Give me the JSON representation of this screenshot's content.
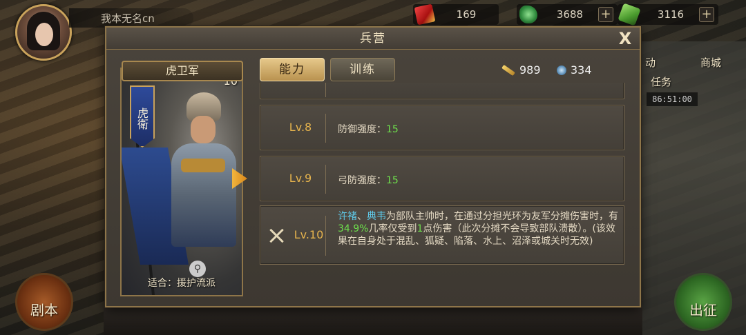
{
  "player": {
    "name": "我本无名cn"
  },
  "resources": [
    {
      "icon": "red-token-icon",
      "value": "169"
    },
    {
      "icon": "jade-icon",
      "value": "3688"
    },
    {
      "icon": "green-gem-icon",
      "value": "3116"
    }
  ],
  "side": {
    "mall_label": "商城",
    "activity_label": "动",
    "task_label": "任务",
    "timer": "86:51:00"
  },
  "bottom": {
    "script_label": "剧本",
    "campaign_label": "出征"
  },
  "modal": {
    "title": "兵营",
    "close": "X",
    "tabs": [
      {
        "label": "能力",
        "active": true
      },
      {
        "label": "训练",
        "active": false
      }
    ],
    "counters": {
      "sword_value": "989",
      "gem_value": "334"
    },
    "card": {
      "name": "虎卫军",
      "level": "10",
      "banner": "虎衛",
      "suitable": "适合：援护流派"
    },
    "rows": [
      {
        "level": "Lv.8",
        "label": "防御强度：",
        "value": "15"
      },
      {
        "level": "Lv.9",
        "label": "弓防强度：",
        "value": "15"
      },
      {
        "level": "Lv.10",
        "name1": "许褚",
        "sep": "、",
        "name2": "典韦",
        "text1": "为部队主帅时，在通过分担光环为友军分摊伤害时，有",
        "percent": "34.9%",
        "text2": "几率仅受到",
        "one": "1",
        "text3": "点伤害（此次分摊不会导致部队溃散）。(该效果在自身处于混乱、狐疑、陷落、水上、沼泽或城关时无效)"
      }
    ]
  },
  "colors": {
    "accent_gold": "#e7b44d",
    "stat_green": "#6ee04c",
    "name_blue": "#5fc9e8"
  }
}
